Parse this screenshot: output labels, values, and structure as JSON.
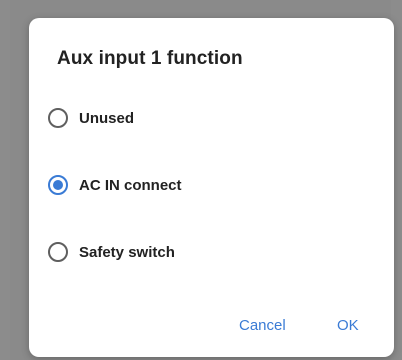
{
  "dialog": {
    "title": "Aux input 1 function",
    "options": [
      {
        "label": "Unused",
        "selected": false
      },
      {
        "label": "AC IN connect",
        "selected": true
      },
      {
        "label": "Safety switch",
        "selected": false
      }
    ],
    "cancel_label": "Cancel",
    "ok_label": "OK"
  },
  "colors": {
    "accent": "#3a7bd5",
    "scrim": "#8a8a8a",
    "dialog_bg": "#ffffff"
  }
}
